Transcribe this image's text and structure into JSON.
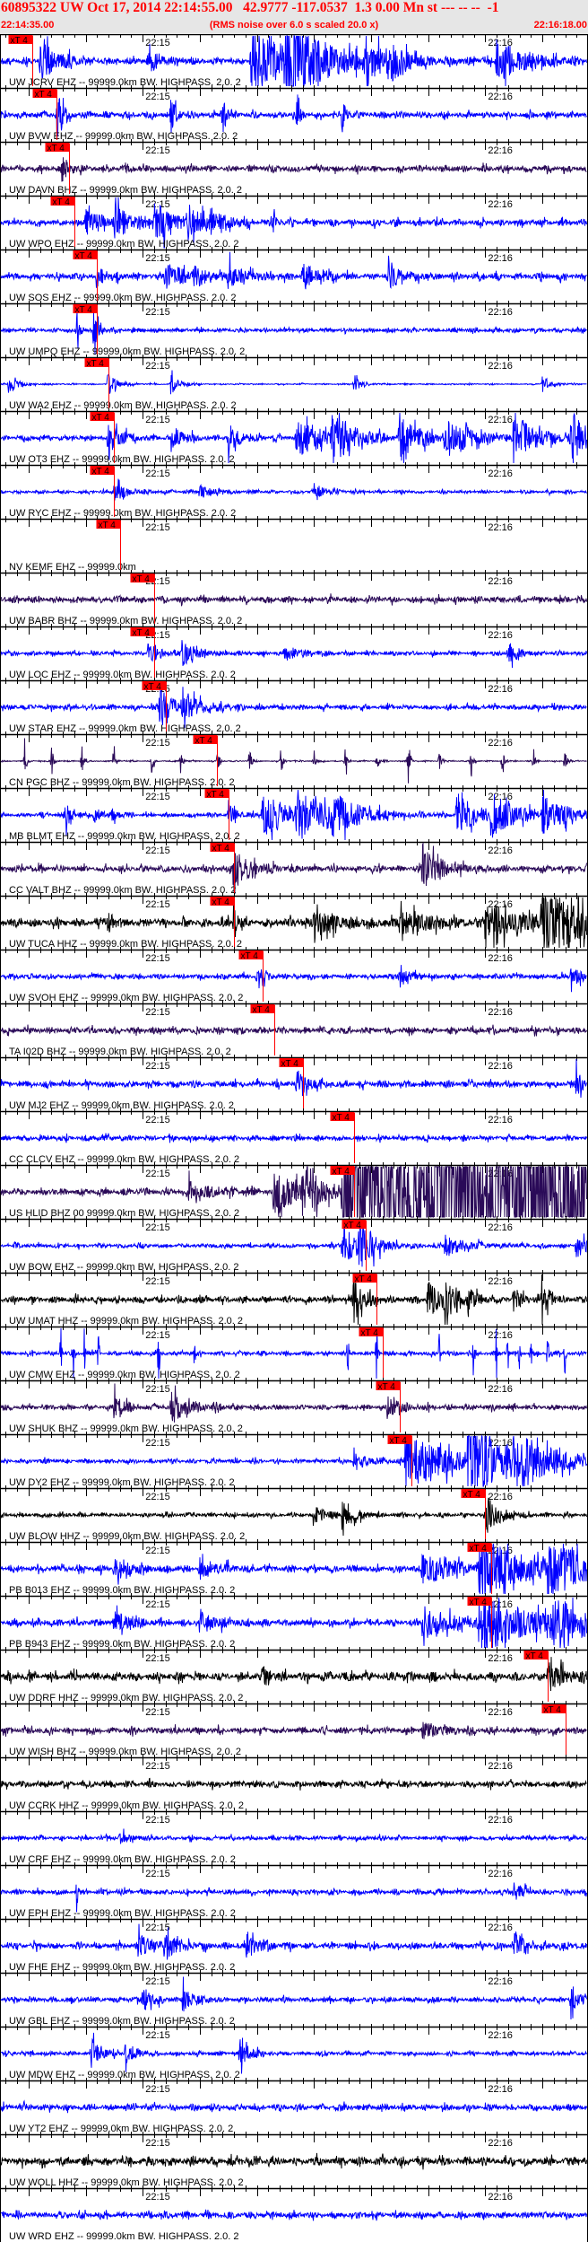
{
  "header": {
    "title": "60895322 UW Oct 17, 2014 22:14:55.00   42.9777 -117.0537  1.3 0.00 Mn st --- -- --  -1",
    "start_time": "22:14:35.00",
    "scaling_note": "(RMS noise over 6.0 s scaled 20.0 x)",
    "end_time": "22:16:18.00"
  },
  "colors": {
    "blue": "#0000ff",
    "purple": "#2a0a58",
    "black": "#000000",
    "pick": "#ff0000",
    "header_bg": "#e6e6e6"
  },
  "chart_data": {
    "type": "line",
    "title": "60895322 UW Oct 17, 2014 22:14:55.00",
    "x_range_s": [
      0,
      103
    ],
    "x_start": "22:14:35.00",
    "x_end": "22:16:18.00",
    "tick_labels": [
      "22:15",
      "22:16"
    ],
    "tick_label_offsets_s": [
      25,
      85
    ],
    "major_tick_s": 10,
    "minor_tick_s": 2,
    "pick_label": "xT 4",
    "traces": [
      {
        "label": "UW JCRV EHZ -- 99999.0km BW. HIGHPASS. 2.0. 2",
        "color": "blue",
        "noise": 0.15,
        "pick_s": 5.7,
        "events": [
          [
            7,
            0.8,
            3
          ],
          [
            26,
            0.5,
            2
          ],
          [
            44,
            1.2,
            10
          ],
          [
            50,
            1.2,
            6
          ],
          [
            64,
            0.8,
            3
          ],
          [
            69,
            0.5,
            2
          ],
          [
            87,
            0.8,
            5
          ]
        ]
      },
      {
        "label": "UW BVW EHZ -- 99999.0km BW. HIGHPASS. 2.0. 2",
        "color": "blue",
        "noise": 0.15,
        "pick_s": 9.9,
        "events": [
          [
            10,
            1.0,
            1
          ],
          [
            30,
            0.8,
            0.8
          ],
          [
            39,
            0.8,
            0.8
          ],
          [
            52,
            0.7,
            0.6
          ],
          [
            60,
            0.7,
            0.6
          ]
        ]
      },
      {
        "label": "UW DAVN BHZ -- 99999.0km BW. HIGHPASS. 2.0. 2",
        "color": "purple",
        "noise": 0.15,
        "pick_s": 12.1,
        "events": [
          [
            11,
            0.5,
            1
          ]
        ]
      },
      {
        "label": "UW WPO EHZ -- 99999.0km BW. HIGHPASS. 2.0. 2",
        "color": "blue",
        "noise": 0.15,
        "pick_s": 13.0,
        "events": [
          [
            15,
            0.5,
            3
          ],
          [
            20,
            0.6,
            3
          ],
          [
            27,
            0.8,
            3
          ],
          [
            33,
            0.6,
            3
          ],
          [
            37,
            0.5,
            2
          ],
          [
            48,
            0.8,
            0.3
          ]
        ]
      },
      {
        "label": "UW SOS EHZ -- 99999.0km BW. HIGHPASS. 2.0. 2",
        "color": "blue",
        "noise": 0.15,
        "pick_s": 17.0,
        "events": [
          [
            17,
            0.3,
            2
          ],
          [
            29,
            0.6,
            3
          ],
          [
            34,
            0.4,
            2
          ],
          [
            40,
            0.5,
            3
          ],
          [
            53,
            0.5,
            3
          ],
          [
            68,
            0.4,
            3
          ]
        ]
      },
      {
        "label": "UW UMPQ EHZ -- 99999.0km BW. HIGHPASS. 2.0. 2",
        "color": "blue",
        "noise": 0.1,
        "pick_s": 17.0,
        "events": [
          [
            13.5,
            0.8,
            0.3
          ],
          [
            16.5,
            1.3,
            0.5
          ]
        ]
      },
      {
        "label": "UW WA2 EHZ -- 99999.0km BW. HIGHPASS. 2.0. 2",
        "color": "blue",
        "noise": 0.03,
        "pick_s": 19.0,
        "events": [
          [
            1.5,
            0.4,
            1.5
          ],
          [
            19,
            0.5,
            1.5
          ],
          [
            30,
            0.4,
            1.5
          ],
          [
            62,
            0.3,
            1.5
          ],
          [
            95,
            0.4,
            1.5
          ]
        ]
      },
      {
        "label": "UW OT3 EHZ -- 99999.0km BW. HIGHPASS. 2.0. 2",
        "color": "blue",
        "noise": 0.12,
        "pick_s": 19.9,
        "events": [
          [
            19,
            0.7,
            2
          ],
          [
            30,
            0.5,
            2
          ],
          [
            40,
            0.6,
            2
          ],
          [
            52,
            0.9,
            4
          ],
          [
            58,
            0.9,
            4
          ],
          [
            70,
            0.8,
            4
          ],
          [
            78,
            0.8,
            4
          ],
          [
            90,
            0.9,
            4
          ],
          [
            100,
            1.1,
            3
          ]
        ]
      },
      {
        "label": "UW RYC EHZ -- 99999.0km BW. HIGHPASS. 2.0. 2",
        "color": "blue",
        "noise": 0.08,
        "pick_s": 19.9,
        "events": [
          [
            20,
            0.4,
            2
          ],
          [
            35,
            0.3,
            2
          ],
          [
            55,
            0.3,
            2
          ]
        ]
      },
      {
        "label": "NV KEMF EHZ -- 99999.0km",
        "color": "none",
        "noise": 0,
        "pick_s": 21.0,
        "events": []
      },
      {
        "label": "UW BABR BHZ -- 99999.0km BW. HIGHPASS. 2.0. 2",
        "color": "purple",
        "noise": 0.15,
        "pick_s": 27.0,
        "events": []
      },
      {
        "label": "UW LOC EHZ -- 99999.0km BW. HIGHPASS. 2.0. 2",
        "color": "blue",
        "noise": 0.1,
        "pick_s": 27.0,
        "events": [
          [
            26,
            0.4,
            2
          ],
          [
            32,
            0.5,
            2
          ],
          [
            50,
            0.4,
            2
          ],
          [
            89,
            0.5,
            1.5
          ]
        ]
      },
      {
        "label": "UW STAR EHZ -- 99999.0km BW. HIGHPASS. 2.0. 2",
        "color": "blue",
        "noise": 0.12,
        "pick_s": 29.0,
        "events": [
          [
            28,
            0.9,
            2
          ],
          [
            32,
            0.5,
            3
          ]
        ]
      },
      {
        "label": "CN PGC BHZ -- 99999.0km BW. HIGHPASS. 2.0. 2",
        "color": "purple",
        "noise": 0.03,
        "pick_s": 38.0,
        "events": [
          [
            4.3,
            0.6,
            0.3
          ],
          [
            9.1,
            0.6,
            0.3
          ],
          [
            14.3,
            0.6,
            0.3
          ],
          [
            19.9,
            0.6,
            0.3
          ],
          [
            26.6,
            0.6,
            0.3
          ],
          [
            31.6,
            0.6,
            0.3
          ],
          [
            38.1,
            0.6,
            0.3
          ],
          [
            43.7,
            0.6,
            0.3
          ],
          [
            49.3,
            0.6,
            0.3
          ],
          [
            55,
            0.6,
            0.3
          ],
          [
            60.5,
            0.6,
            0.3
          ],
          [
            66,
            0.6,
            0.3
          ],
          [
            71.5,
            0.6,
            0.3
          ],
          [
            77,
            0.6,
            0.3
          ],
          [
            82.5,
            0.6,
            0.3
          ],
          [
            88,
            0.6,
            0.3
          ],
          [
            93.5,
            0.6,
            0.3
          ],
          [
            99,
            0.6,
            0.3
          ]
        ]
      },
      {
        "label": "MB BLMT EHZ -- 99999.0km BW. HIGHPASS. 2.0. 2",
        "color": "blue",
        "noise": 0.1,
        "pick_s": 40.0,
        "events": [
          [
            11.5,
            0.5,
            1
          ],
          [
            16.5,
            0.4,
            1
          ],
          [
            19.5,
            0.3,
            1
          ],
          [
            40,
            0.5,
            1
          ],
          [
            46,
            0.9,
            5
          ],
          [
            52,
            0.9,
            5
          ],
          [
            58,
            0.7,
            4
          ],
          [
            80,
            0.8,
            4
          ],
          [
            86,
            0.8,
            4
          ],
          [
            95,
            0.8,
            4
          ]
        ]
      },
      {
        "label": "CC VALT BHZ -- 99999.0km BW. HIGHPASS. 2.0. 2",
        "color": "purple",
        "noise": 0.15,
        "pick_s": 41.0,
        "events": [
          [
            41,
            0.7,
            3
          ],
          [
            74,
            0.9,
            3
          ]
        ]
      },
      {
        "label": "UW TUCA HHZ -- 99999.0km BW. HIGHPASS. 2.0. 2",
        "color": "black",
        "noise": 0.2,
        "pick_s": 41.0,
        "events": [
          [
            19,
            0.6,
            0.5
          ],
          [
            41,
            1.0,
            0.5
          ],
          [
            55,
            0.5,
            4
          ],
          [
            70,
            0.5,
            5
          ],
          [
            85,
            0.8,
            6
          ],
          [
            95,
            1.2,
            8
          ]
        ]
      },
      {
        "label": "UW SVOH EHZ -- 99999.0km BW. HIGHPASS. 2.0. 2",
        "color": "blue",
        "noise": 0.12,
        "pick_s": 46.0,
        "events": [
          [
            45,
            0.3,
            1.5
          ],
          [
            70,
            0.3,
            2
          ],
          [
            100,
            0.4,
            1.5
          ]
        ]
      },
      {
        "label": "TA I02D BHZ -- 99999.0km BW. HIGHPASS. 2.0. 2",
        "color": "purple",
        "noise": 0.15,
        "pick_s": 48.0,
        "events": []
      },
      {
        "label": "UW MJ2 EHZ -- 99999.0km BW. HIGHPASS. 2.0. 2",
        "color": "blue",
        "noise": 0.15,
        "pick_s": 53.1,
        "events": [
          [
            52,
            0.5,
            2
          ],
          [
            101,
            0.6,
            1
          ]
        ]
      },
      {
        "label": "CC CLCV EHZ -- 99999.0km BW. HIGHPASS. 2.0. 2",
        "color": "blue",
        "noise": 0.12,
        "pick_s": 62.0,
        "events": []
      },
      {
        "label": "US HLID BHZ 00 99999.0km BW. HIGHPASS. 2.0. 2",
        "color": "purple",
        "noise": 0.15,
        "pick_s": 62.0,
        "events": [
          [
            33,
            0.4,
            3
          ],
          [
            48,
            1.2,
            3
          ],
          [
            53,
            1.2,
            3
          ],
          [
            60,
            3.0,
            30
          ],
          [
            75,
            3.0,
            30
          ],
          [
            90,
            3.0,
            20
          ]
        ]
      },
      {
        "label": "UW BOW EHZ -- 99999.0km BW. HIGHPASS. 2.0. 2",
        "color": "blue",
        "noise": 0.1,
        "pick_s": 64.1,
        "events": [
          [
            60,
            0.8,
            3
          ],
          [
            63,
            1.0,
            2
          ],
          [
            78,
            0.5,
            3
          ],
          [
            101,
            0.4,
            2
          ]
        ]
      },
      {
        "label": "UW UMAT HHZ -- 99999.0km BW. HIGHPASS. 2.0. 2",
        "color": "black",
        "noise": 0.15,
        "pick_s": 65.9,
        "events": [
          [
            62,
            1.0,
            1.5
          ],
          [
            75,
            0.8,
            1.5
          ],
          [
            78,
            0.8,
            1.5
          ],
          [
            82,
            0.6,
            1
          ],
          [
            90,
            0.6,
            1
          ],
          [
            95,
            0.9,
            1
          ]
        ]
      },
      {
        "label": "UW CMW EHZ -- 99999.0km BW. HIGHPASS. 2.0. 2",
        "color": "blue",
        "noise": 0.1,
        "pick_s": 67.0,
        "events": [
          [
            10.7,
            1.3,
            0.1
          ],
          [
            12.8,
            1.3,
            0.1
          ],
          [
            14.8,
            1.3,
            0.1
          ],
          [
            17.3,
            1.3,
            0.1
          ],
          [
            27.8,
            1.3,
            0.1
          ],
          [
            34.2,
            1.3,
            0.1
          ],
          [
            61,
            1.3,
            0.1
          ],
          [
            66,
            1.3,
            0.1
          ],
          [
            77,
            1.3,
            0.1
          ],
          [
            83,
            1.3,
            0.1
          ],
          [
            87,
            1.0,
            0.1
          ],
          [
            89,
            1.3,
            0.1
          ],
          [
            91,
            1.0,
            0.1
          ],
          [
            93,
            1.3,
            0.1
          ],
          [
            96,
            1.3,
            0.1
          ],
          [
            99,
            1.3,
            0.1
          ]
        ]
      },
      {
        "label": "UW SHUK BHZ -- 99999.0km BW. HIGHPASS. 2.0. 2",
        "color": "purple",
        "noise": 0.12,
        "pick_s": 70.0,
        "events": [
          [
            20,
            0.5,
            2
          ],
          [
            30,
            0.6,
            3
          ],
          [
            68,
            0.4,
            2
          ]
        ]
      },
      {
        "label": "UW DY2 EHZ -- 99999.0km BW. HIGHPASS. 2.0. 2",
        "color": "blue",
        "noise": 0.1,
        "pick_s": 72.1,
        "events": [
          [
            62,
            0.3,
            3
          ],
          [
            71,
            1.2,
            8
          ],
          [
            82,
            1.2,
            8
          ],
          [
            90,
            0.8,
            6
          ]
        ]
      },
      {
        "label": "UW BLOW HHZ -- 99999.0km BW. HIGHPASS. 2.0. 2",
        "color": "black",
        "noise": 0.1,
        "pick_s": 84.9,
        "events": [
          [
            55,
            0.4,
            2
          ],
          [
            60,
            0.5,
            2
          ],
          [
            85,
            1.0,
            2
          ]
        ]
      },
      {
        "label": "PB B013 EHZ -- 99999.0km BW. HIGHPASS. 2.0. 2",
        "color": "blue",
        "noise": 0.15,
        "pick_s": 86.0,
        "events": [
          [
            20,
            0.4,
            3
          ],
          [
            35,
            0.4,
            3
          ],
          [
            74,
            0.6,
            6
          ],
          [
            84,
            1.2,
            8
          ],
          [
            96,
            1.0,
            6
          ]
        ]
      },
      {
        "label": "PB B943 EHZ -- 99999.0km BW. HIGHPASS. 2.0. 2",
        "color": "blue",
        "noise": 0.15,
        "pick_s": 86.0,
        "events": [
          [
            20,
            0.4,
            3
          ],
          [
            35,
            0.4,
            3
          ],
          [
            74,
            0.6,
            6
          ],
          [
            84,
            1.2,
            8
          ],
          [
            96,
            1.0,
            6
          ]
        ]
      },
      {
        "label": "UW DDRF HHZ -- 99999.0km BW. HIGHPASS. 2.0. 2",
        "color": "black",
        "noise": 0.2,
        "pick_s": 95.9,
        "events": [
          [
            46,
            0.4,
            1
          ],
          [
            96,
            0.5,
            3
          ]
        ]
      },
      {
        "label": "UW WISH BHZ -- 99999.0km BW. HIGHPASS. 2.0. 2",
        "color": "purple",
        "noise": 0.15,
        "pick_s": 99.1,
        "events": [
          [
            74,
            0.3,
            3
          ]
        ]
      },
      {
        "label": "UW CCRK HHZ -- 99999.0km BW. HIGHPASS. 2.0. 2",
        "color": "black",
        "noise": 0.15,
        "pick_s": null,
        "events": []
      },
      {
        "label": "UW CRF EHZ -- 99999.0km BW. HIGHPASS. 2.0. 2",
        "color": "blue",
        "noise": 0.1,
        "pick_s": null,
        "events": [
          [
            21,
            0.2,
            2
          ]
        ]
      },
      {
        "label": "UW EPH EHZ -- 99999.0km BW. HIGHPASS. 2.0. 2",
        "color": "blue",
        "noise": 0.12,
        "pick_s": null,
        "events": [
          [
            13.5,
            1.1,
            0.1
          ],
          [
            90,
            0.4,
            1.5
          ]
        ]
      },
      {
        "label": "UW FHE EHZ -- 99999.0km BW. HIGHPASS. 2.0. 2",
        "color": "blue",
        "noise": 0.15,
        "pick_s": null,
        "events": [
          [
            24,
            0.5,
            2
          ],
          [
            29,
            0.6,
            2
          ],
          [
            43,
            0.6,
            2
          ],
          [
            90,
            0.5,
            2
          ]
        ]
      },
      {
        "label": "UW GBL EHZ -- 99999.0km BW. HIGHPASS. 2.0. 2",
        "color": "blue",
        "noise": 0.12,
        "pick_s": null,
        "events": [
          [
            25,
            0.5,
            1.5
          ],
          [
            32,
            0.6,
            1.5
          ],
          [
            100,
            0.5,
            1.5
          ]
        ]
      },
      {
        "label": "UW MDW EHZ -- 99999.0km BW. HIGHPASS. 2.0. 2",
        "color": "blue",
        "noise": 0.1,
        "pick_s": null,
        "events": [
          [
            16,
            0.6,
            1.5
          ],
          [
            22,
            0.5,
            1.5
          ],
          [
            42,
            0.6,
            1.5
          ]
        ]
      },
      {
        "label": "UW YT2 EHZ -- 99999.0km BW. HIGHPASS. 2.0. 2",
        "color": "blue",
        "noise": 0.15,
        "pick_s": null,
        "events": []
      },
      {
        "label": "UW WOLL HHZ -- 99999.0km BW. HIGHPASS. 2.0. 2",
        "color": "black",
        "noise": 0.2,
        "pick_s": null,
        "events": []
      },
      {
        "label": "UW WRD EHZ -- 99999.0km BW. HIGHPASS. 2.0. 2",
        "color": "blue",
        "noise": 0.15,
        "pick_s": null,
        "events": []
      }
    ]
  }
}
